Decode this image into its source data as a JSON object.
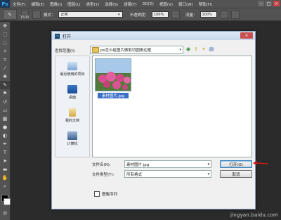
{
  "app": {
    "logo": "Ps"
  },
  "menu": [
    "文件(F)",
    "编辑(E)",
    "图像(I)",
    "图层(L)",
    "类型(Y)",
    "选择(S)",
    "滤镜(T)",
    "3D(D)",
    "视图(V)",
    "窗口(W)",
    "帮助(H)"
  ],
  "window_controls": {
    "minimize": "−",
    "maximize": "□",
    "close": "×"
  },
  "options": {
    "brush_size": "1500",
    "mode_label": "模式：",
    "mode_value": "正常",
    "opacity_label": "不透明度：",
    "opacity_value": "100%",
    "flow_label": "流量：",
    "flow_value": "100%"
  },
  "dialog": {
    "title": "打开",
    "close": "×",
    "look_in_label": "查找范围(I):",
    "look_in_value": "ps怎么给图片做剪切圆角边框",
    "places": [
      "最近使用的项目",
      "桌面",
      "我的文档",
      "计算机"
    ],
    "file": {
      "name": "素材图片.jpg"
    },
    "filename_label": "文件名(N):",
    "filename_value": "素材图片.jpg",
    "filetype_label": "文件类型(T):",
    "filetype_value": "所有格式",
    "open_button": "打开(O)",
    "cancel_button": "取消",
    "image_sequence_label": "图像序列"
  },
  "watermark": "jingyan.baidu.com",
  "colors": {
    "panel": "#535353",
    "workspace": "#2b2b2b",
    "selection": "#3a70c8",
    "arrow": "#cc1a1a"
  }
}
